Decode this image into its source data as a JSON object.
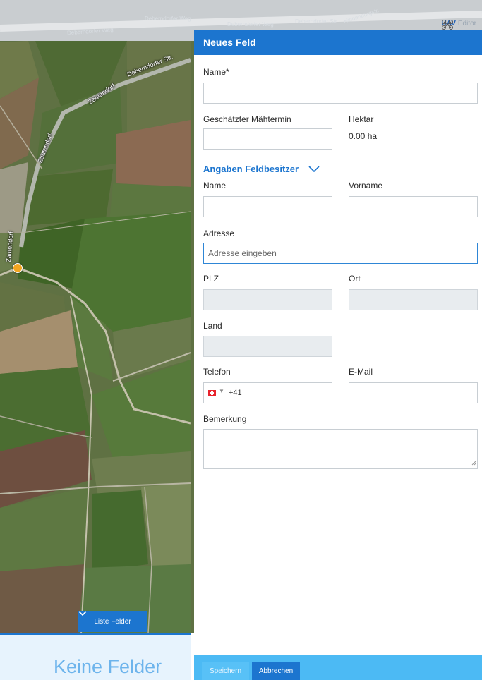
{
  "map": {
    "top_labels": [
      "Deberndorfer Weg",
      "Deberndorfer Weg",
      "Deberndorfer Str.",
      "Deberndorfer Weg",
      "Hindenburgstr."
    ],
    "road_labels": {
      "deberndorfer": "Deberndorfer Str.",
      "zautendorf_top": "Zautendorf",
      "zautendorf_left": "Zautendorf",
      "zautendorf_vertical": "Zautendorf"
    },
    "brand": {
      "part1": "UAV",
      "part2": "Editor"
    },
    "list_button_label": "Liste Felder",
    "empty_title": "Keine Felder"
  },
  "panel": {
    "title": "Neues Feld",
    "name_label": "Name*",
    "name_value": "",
    "mow_label": "Geschätzter Mähtermin",
    "mow_value": "",
    "hectare_label": "Hektar",
    "hectare_value": "0.00 ha",
    "owner_section": "Angaben Feldbesitzer",
    "owner_name_label": "Name",
    "owner_firstname_label": "Vorname",
    "address_label": "Adresse",
    "address_placeholder": "Adresse eingeben",
    "zip_label": "PLZ",
    "city_label": "Ort",
    "country_label": "Land",
    "phone_label": "Telefon",
    "phone_code": "+41",
    "email_label": "E-Mail",
    "remark_label": "Bemerkung",
    "remark_value": ""
  },
  "footer": {
    "save_label": "Speichern",
    "cancel_label": "Abbrechen"
  },
  "colors": {
    "primary": "#1c75cf",
    "footer": "#4cbaf4",
    "marker": "#f2a521",
    "empty_text": "#6db4ec"
  }
}
